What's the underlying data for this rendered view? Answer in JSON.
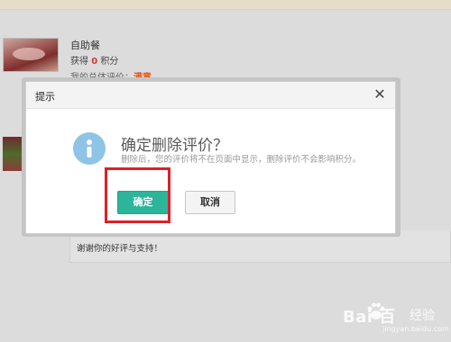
{
  "background": {
    "item_name": "自助餐",
    "points_prefix": "获得",
    "points_value": "0",
    "points_suffix": "积分",
    "rating_prefix": "我的总体评价：",
    "rating_value": "满意",
    "thanks_text": "谢谢你的好评与支持！"
  },
  "modal": {
    "title": "提示",
    "close_symbol": "✕",
    "question": "确定删除评价？",
    "description": "删除后，您的评价将不在页面中显示，删除评价不会影响积分。",
    "ok_label": "确定",
    "cancel_label": "取消"
  },
  "watermark": {
    "brand": "Bai 百",
    "sub": "经验",
    "url": "jingyan.baidu.com"
  },
  "colors": {
    "ok_button": "#2bb59a",
    "info_icon": "#8ec4e6",
    "highlight": "#e01f26",
    "rating_accent": "#e25a1c"
  }
}
